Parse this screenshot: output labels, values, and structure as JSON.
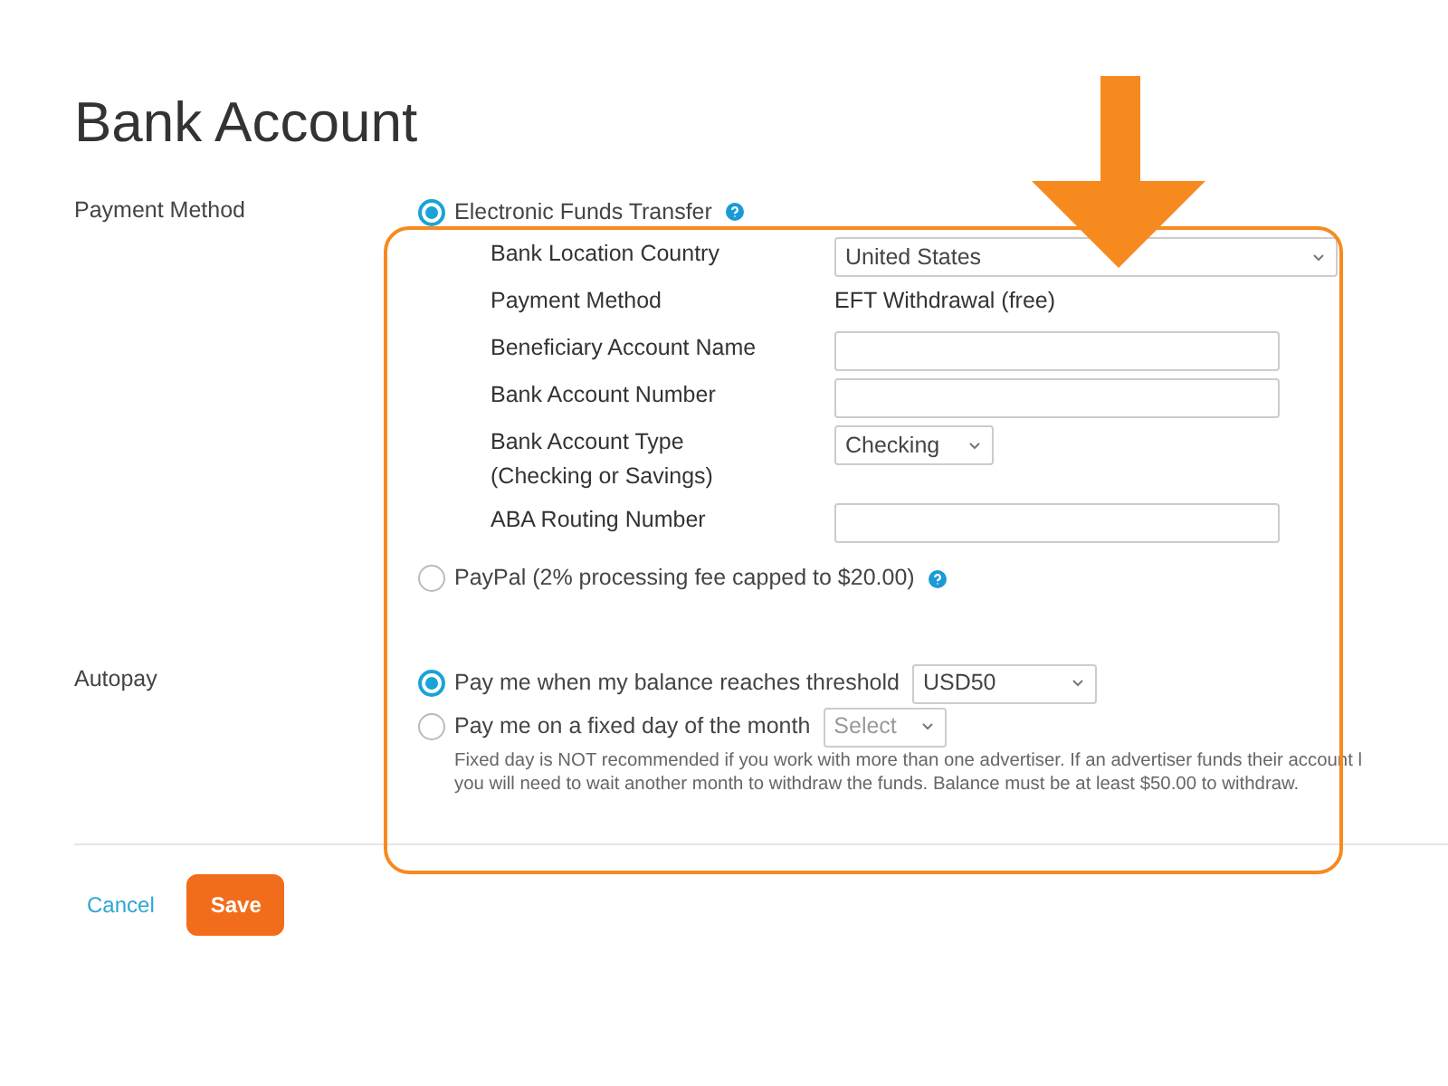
{
  "title": "Bank Account",
  "payment_method": {
    "label": "Payment Method",
    "options": [
      {
        "label": "Electronic Funds Transfer",
        "selected": true,
        "fields": [
          {
            "kind": "select",
            "label": "Bank Location Country",
            "value": "United States"
          },
          {
            "kind": "text",
            "label": "Payment Method",
            "value": "EFT Withdrawal (free)"
          },
          {
            "kind": "input",
            "label": "Beneficiary Account Name"
          },
          {
            "kind": "input",
            "label": "Bank Account Number"
          },
          {
            "kind": "small-select",
            "label": "Bank Account Type",
            "sublabel": "(Checking or Savings)",
            "value": "Checking"
          },
          {
            "kind": "input",
            "label": "ABA Routing Number"
          }
        ]
      },
      {
        "label": "PayPal (2% processing fee capped to $20.00)",
        "selected": false
      }
    ]
  },
  "autopay": {
    "label": "Autopay",
    "options": [
      {
        "label": "Pay me when my balance reaches threshold",
        "selected": true,
        "select": {
          "value": "USD50"
        }
      },
      {
        "label": "Pay me on a fixed day of the month",
        "selected": false,
        "select": {
          "placeholder": "Select"
        }
      }
    ],
    "note": [
      "Fixed day is NOT recommended if you work with more than one advertiser. If an advertiser funds their account l",
      "you will need to wait another month to withdraw the funds. Balance must be at least $50.00 to withdraw."
    ]
  },
  "buttons": {
    "cancel": "Cancel",
    "save": "Save"
  }
}
